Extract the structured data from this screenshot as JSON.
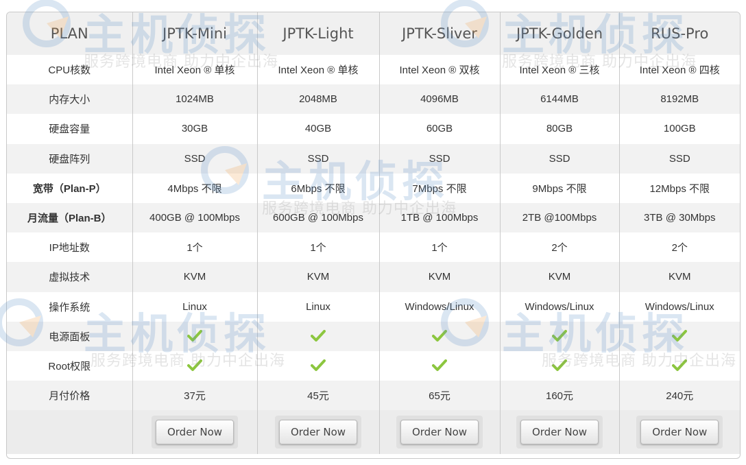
{
  "watermark": {
    "brand": "主机侦探",
    "slogan": "服务跨境电商 助力中企出海",
    "logo_icon": "globe-arrow-logo",
    "colors": {
      "logo_blue": "#5b8fc7",
      "logo_orange": "#f0a04b"
    }
  },
  "table": {
    "header": [
      "PLAN",
      "JPTK-Mini",
      "JPTK-Light",
      "JPTK-Sliver",
      "JPTK-Golden",
      "RUS-Pro"
    ],
    "rows": [
      {
        "label": "CPU核数",
        "bold": false,
        "cells": [
          "Intel Xeon ® 单核",
          "Intel Xeon ® 单核",
          "Intel Xeon ® 双核",
          "Intel Xeon ® 三核",
          "Intel Xeon ® 四核"
        ]
      },
      {
        "label": "内存大小",
        "bold": false,
        "cells": [
          "1024MB",
          "2048MB",
          "4096MB",
          "6144MB",
          "8192MB"
        ]
      },
      {
        "label": "硬盘容量",
        "bold": false,
        "cells": [
          "30GB",
          "40GB",
          "60GB",
          "80GB",
          "100GB"
        ]
      },
      {
        "label": "硬盘阵列",
        "bold": false,
        "cells": [
          "SSD",
          "SSD",
          "SSD",
          "SSD",
          "SSD"
        ]
      },
      {
        "label": "宽带（Plan-P）",
        "bold": true,
        "cells": [
          "4Mbps 不限",
          "6Mbps 不限",
          "7Mbps 不限",
          "9Mbps 不限",
          "12Mbps 不限"
        ]
      },
      {
        "label": "月流量（Plan-B）",
        "bold": true,
        "cells": [
          "400GB @ 100Mbps",
          "600GB @ 100Mbps",
          "1TB @ 100Mbps",
          "2TB @100Mbps",
          "3TB @ 30Mbps"
        ]
      },
      {
        "label": "IP地址数",
        "bold": false,
        "cells": [
          "1个",
          "1个",
          "1个",
          "2个",
          "2个"
        ]
      },
      {
        "label": "虚拟技术",
        "bold": false,
        "cells": [
          "KVM",
          "KVM",
          "KVM",
          "KVM",
          "KVM"
        ]
      },
      {
        "label": "操作系统",
        "bold": false,
        "cells": [
          "Linux",
          "Linux",
          "Windows/Linux",
          "Windows/Linux",
          "Windows/Linux"
        ]
      },
      {
        "label": "电源面板",
        "bold": false,
        "check": true
      },
      {
        "label": "Root权限",
        "bold": false,
        "check": true
      },
      {
        "label": "月付价格",
        "bold": false,
        "cells": [
          "37元",
          "45元",
          "65元",
          "160元",
          "240元"
        ]
      }
    ],
    "order_button_label": "Order Now",
    "check_icon": "checkmark-icon",
    "check_color": "#8cc63f"
  }
}
